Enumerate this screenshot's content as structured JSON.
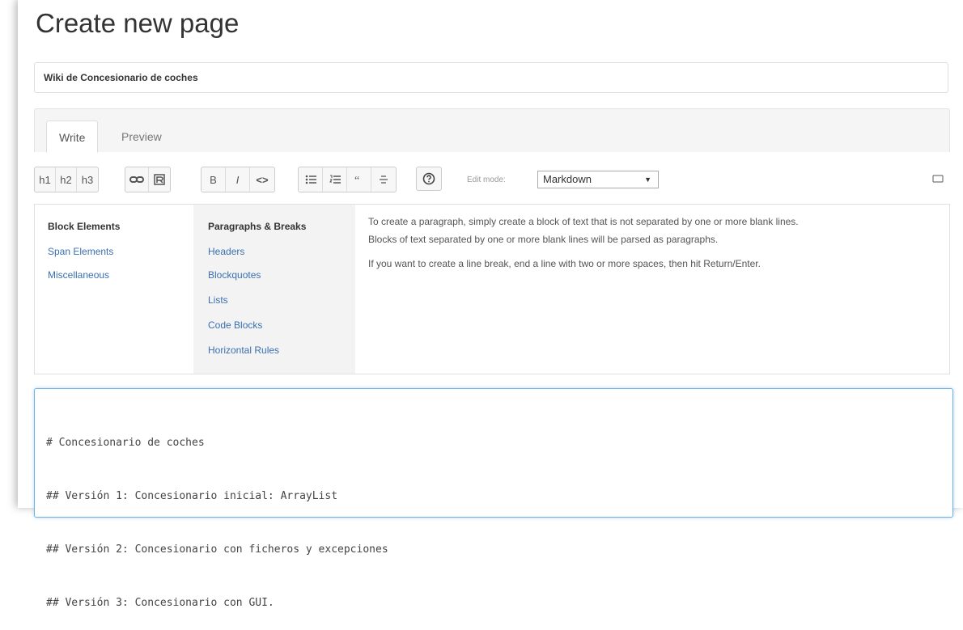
{
  "page": {
    "heading": "Create new page",
    "title_value": "Wiki de Concesionario de coches"
  },
  "tabs": [
    {
      "label": "Write",
      "active": true
    },
    {
      "label": "Preview",
      "active": false
    }
  ],
  "toolbar": {
    "h1": "h1",
    "h2": "h2",
    "h3": "h3",
    "bold": "B",
    "italic": "I",
    "code": "<>",
    "edit_mode_label": "Edit mode:",
    "edit_mode_value": "Markdown"
  },
  "help": {
    "categories": [
      {
        "label": "Block Elements",
        "selected": true
      },
      {
        "label": "Span Elements",
        "selected": false
      },
      {
        "label": "Miscellaneous",
        "selected": false
      }
    ],
    "topics": [
      {
        "label": "Paragraphs & Breaks",
        "selected": true
      },
      {
        "label": "Headers",
        "selected": false
      },
      {
        "label": "Blockquotes",
        "selected": false
      },
      {
        "label": "Lists",
        "selected": false
      },
      {
        "label": "Code Blocks",
        "selected": false
      },
      {
        "label": "Horizontal Rules",
        "selected": false
      }
    ],
    "text_lines": [
      "To create a paragraph, simply create a block of text that is not separated by one or more blank lines.",
      "Blocks of text separated by one or more blank lines will be parsed as paragraphs.",
      "If you want to create a line break, end a line with two or more spaces, then hit Return/Enter."
    ]
  },
  "editor": {
    "lines": [
      "# Concesionario de coches",
      "## Versión 1: Concesionario inicial: ArrayList",
      "## Versión 2: Concesionario con ficheros y excepciones",
      "## Versión 3: Concesionario con GUI."
    ]
  }
}
